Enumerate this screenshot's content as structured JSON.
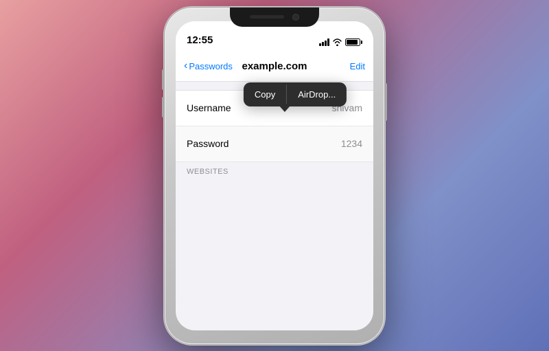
{
  "scene": {
    "background": "gradient"
  },
  "status_bar": {
    "time": "12:55",
    "signal_label": "signal",
    "wifi_label": "wifi",
    "battery_label": "battery"
  },
  "nav_bar": {
    "back_label": "Passwords",
    "title": "example.com",
    "edit_label": "Edit"
  },
  "rows": [
    {
      "label": "Username",
      "value": "shivam"
    },
    {
      "label": "Password",
      "value": "1234"
    }
  ],
  "context_menu": {
    "items": [
      {
        "label": "Copy"
      },
      {
        "label": "AirDrop..."
      }
    ]
  },
  "websites_section": {
    "label": "WEBSITES"
  }
}
